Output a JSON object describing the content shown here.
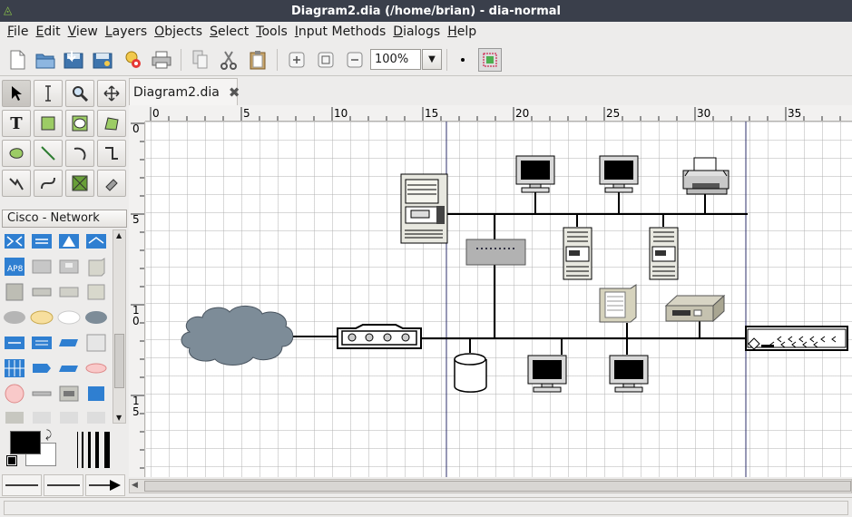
{
  "window": {
    "title": "Diagram2.dia (/home/brian) - dia-normal"
  },
  "menu": [
    "File",
    "Edit",
    "View",
    "Layers",
    "Objects",
    "Select",
    "Tools",
    "Input Methods",
    "Dialogs",
    "Help"
  ],
  "toolbar": {
    "buttons": [
      "new-icon",
      "open-icon",
      "save-icon",
      "save-as-icon",
      "export-icon",
      "print-icon",
      "copy-icon",
      "cut-icon",
      "paste-icon",
      "zoom-in-icon",
      "zoom-fit-icon",
      "zoom-out-icon"
    ],
    "zoom": "100%"
  },
  "tools": [
    "pointer-tool",
    "text-edit-tool",
    "magnify-tool",
    "scroll-tool",
    "text-tool",
    "box-tool",
    "ellipse-tool",
    "polygon-tool",
    "beziergon-tool",
    "line-tool",
    "arc-tool",
    "zigzag-tool",
    "polyline-tool",
    "bezier-tool",
    "image-tool",
    "outline-tool"
  ],
  "sheet": {
    "name": "Cisco - Network"
  },
  "tab": {
    "label": "Diagram2.dia"
  },
  "rulers": {
    "h": [
      "0",
      "5",
      "10",
      "15",
      "20",
      "25",
      "30",
      "35"
    ],
    "v": [
      "0",
      "5",
      "1\n0",
      "1\n5"
    ]
  },
  "colors": {
    "foreground": "#000000",
    "background": "#ffffff",
    "device": "#7a8590",
    "cloud": "#7d8c98",
    "titlebar": "#3a3f4b"
  }
}
